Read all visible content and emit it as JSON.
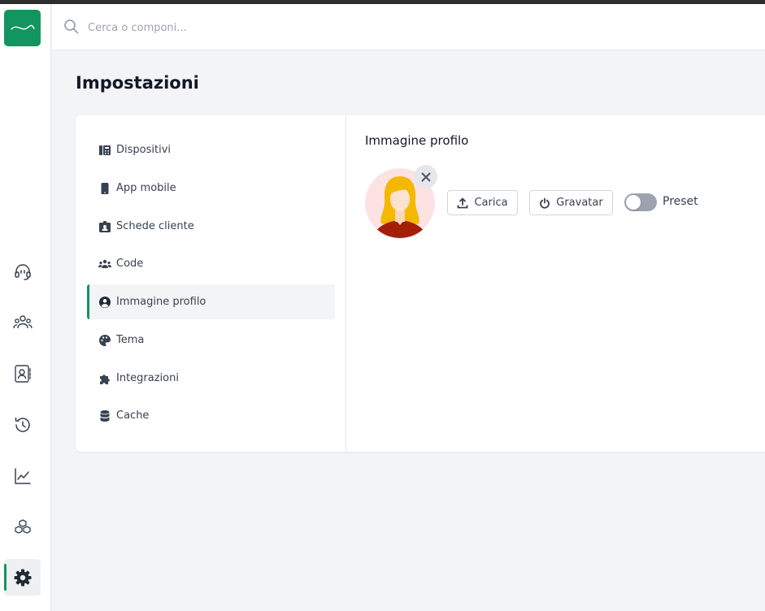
{
  "search": {
    "placeholder": "Cerca o componi..."
  },
  "page": {
    "title": "Impostazioni"
  },
  "sidebar": {
    "items": [
      {
        "name": "support",
        "icon": "headset-icon"
      },
      {
        "name": "users",
        "icon": "users-icon"
      },
      {
        "name": "contacts",
        "icon": "address-book-icon"
      },
      {
        "name": "history",
        "icon": "history-icon"
      },
      {
        "name": "analytics",
        "icon": "chart-line-icon"
      },
      {
        "name": "apps",
        "icon": "cubes-icon"
      },
      {
        "name": "settings",
        "icon": "gear-icon",
        "active": true
      }
    ]
  },
  "settings_nav": {
    "items": [
      {
        "label": "Dispositivi",
        "icon": "device-phone-icon"
      },
      {
        "label": "App mobile",
        "icon": "mobile-icon"
      },
      {
        "label": "Schede cliente",
        "icon": "id-badge-icon"
      },
      {
        "label": "Code",
        "icon": "users-group-icon"
      },
      {
        "label": "Immagine profilo",
        "icon": "user-circle-icon",
        "active": true
      },
      {
        "label": "Tema",
        "icon": "palette-icon"
      },
      {
        "label": "Integrazioni",
        "icon": "puzzle-icon"
      },
      {
        "label": "Cache",
        "icon": "database-icon"
      }
    ]
  },
  "profile": {
    "title": "Immagine profilo",
    "upload_label": "Carica",
    "gravatar_label": "Gravatar",
    "preset_label": "Preset",
    "preset_enabled": false
  },
  "colors": {
    "brand": "#13955f",
    "active_bg": "#f3f4f6",
    "toggle_off": "#9ca3af",
    "avatar_bg": "#fde2e4"
  }
}
